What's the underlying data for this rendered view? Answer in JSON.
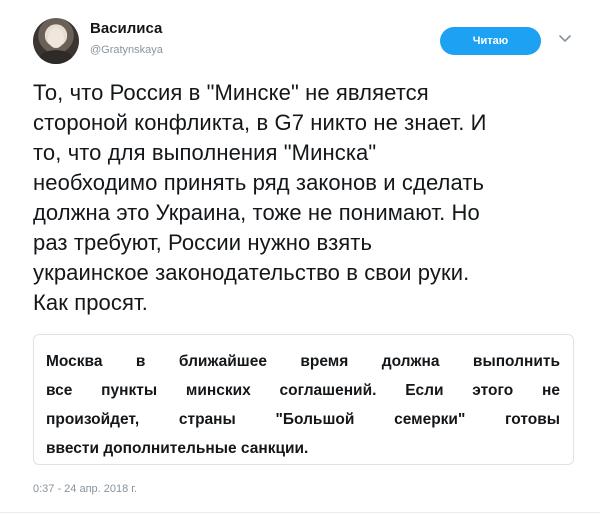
{
  "user": {
    "display_name": "Василиса",
    "handle": "@Gratynskaya",
    "avatar": "avatar-photo"
  },
  "header": {
    "follow_label": "Читаю",
    "menu_icon": "chevron-down-icon",
    "accent": "#1da1f2"
  },
  "tweet": {
    "lines": [
      "То, что Россия в \"Минске\" не является",
      "стороной конфликта, в G7 никто не знает. И",
      "то, что для выполнения \"Минска\"",
      "необходимо принять ряд законов и сделать",
      "должна это Украина, тоже не понимают. Но",
      "раз требуют, России нужно взять",
      "украинское законодательство в свои руки.",
      "Как просят."
    ]
  },
  "quote": {
    "lines": [
      "Москва в ближайшее время должна выполнить",
      "все пункты минских соглашений. Если этого не",
      "произойдет, страны \"Большой семерки\" готовы",
      "ввести дополнительные санкции."
    ]
  },
  "meta": {
    "timestamp": "0:37 - 24 апр. 2018 г."
  }
}
